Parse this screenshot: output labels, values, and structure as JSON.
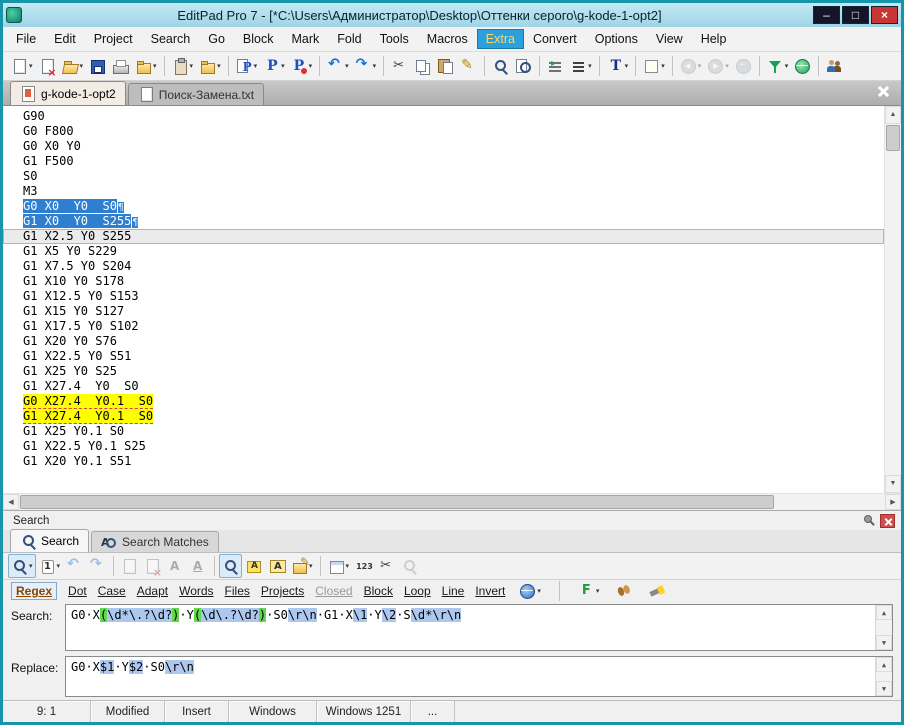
{
  "window": {
    "title": "EditPad Pro 7 - [*C:\\Users\\Администратор\\Desktop\\Оттенки серого\\g-kode-1-opt2]",
    "controls": [
      {
        "name": "minimize",
        "glyph": "–"
      },
      {
        "name": "maximize",
        "glyph": "□"
      },
      {
        "name": "close",
        "glyph": "×"
      }
    ]
  },
  "glyphs": {
    "dropdown": "▾",
    "up": "▲",
    "down": "▼",
    "left": "◀",
    "right": "▶",
    "pilcrow": "¶"
  },
  "menu_bar": {
    "active": "Extra",
    "items": [
      "File",
      "Edit",
      "Project",
      "Search",
      "Go",
      "Block",
      "Mark",
      "Fold",
      "Tools",
      "Macros",
      "Extra",
      "Convert",
      "Options",
      "View",
      "Help"
    ]
  },
  "main_toolbar": [
    {
      "name": "new-file",
      "icon": "page",
      "dd": true
    },
    {
      "name": "close-file",
      "icon": "page-x"
    },
    {
      "name": "open-file",
      "icon": "folder-open",
      "dd": true
    },
    {
      "name": "save",
      "icon": "floppy"
    },
    {
      "name": "print",
      "icon": "printer"
    },
    {
      "name": "favorites",
      "icon": "folder",
      "dd": true
    },
    {
      "sep": true
    },
    {
      "name": "clipboard-file",
      "icon": "clip",
      "dd": true
    },
    {
      "name": "export",
      "icon": "folder",
      "dd": true
    },
    {
      "sep": true
    },
    {
      "name": "open-project",
      "icon": "P-page",
      "dd": true
    },
    {
      "name": "save-project",
      "icon": "P",
      "dd": true
    },
    {
      "name": "close-project",
      "icon": "P-x",
      "dd": true
    },
    {
      "sep": true
    },
    {
      "name": "undo",
      "icon": "undo",
      "dd": true
    },
    {
      "name": "redo",
      "icon": "redo",
      "dd": true
    },
    {
      "sep": true
    },
    {
      "name": "cut",
      "icon": "cut"
    },
    {
      "name": "copy",
      "icon": "copy"
    },
    {
      "name": "paste",
      "icon": "paste"
    },
    {
      "name": "edit",
      "icon": "pencil"
    },
    {
      "sep": true
    },
    {
      "name": "search",
      "icon": "mag"
    },
    {
      "name": "search-files",
      "icon": "mag-doc"
    },
    {
      "sep": true
    },
    {
      "name": "indent",
      "icon": "indent"
    },
    {
      "name": "view-list",
      "icon": "list",
      "dd": true
    },
    {
      "sep": true
    },
    {
      "name": "font",
      "icon": "T",
      "dd": true
    },
    {
      "sep": true
    },
    {
      "name": "insert-symbol",
      "icon": "box",
      "dd": true
    },
    {
      "sep": true
    },
    {
      "name": "nav-back",
      "icon": "nav-back",
      "dd": true,
      "disabled": true
    },
    {
      "name": "nav-forward",
      "icon": "nav-fwd",
      "dd": true,
      "disabled": true
    },
    {
      "name": "nav-stop",
      "icon": "nav-stop",
      "disabled": true
    },
    {
      "sep": true
    },
    {
      "name": "filter",
      "icon": "funnel",
      "dd": true
    },
    {
      "name": "help-web",
      "icon": "globe"
    },
    {
      "sep": true
    },
    {
      "name": "forum",
      "icon": "people"
    }
  ],
  "document_tabs": [
    {
      "label": "g-kode-1-opt2",
      "active": true
    },
    {
      "label": "Поиск-Замена.txt",
      "active": false
    }
  ],
  "editor": {
    "lines": [
      {
        "text": "G90"
      },
      {
        "text": "G0 F800"
      },
      {
        "text": "G0 X0 Y0"
      },
      {
        "text": "G1 F500"
      },
      {
        "text": "S0"
      },
      {
        "text": "M3"
      },
      {
        "text": "G0 X0  Y0  S0",
        "hl": "selection",
        "eol": true
      },
      {
        "text": "G1 X0  Y0  S255",
        "hl": "selection",
        "eol": true
      },
      {
        "text": "G1 X2.5 Y0 S255",
        "hl": "current"
      },
      {
        "text": "G1 X5 Y0 S229"
      },
      {
        "text": "G1 X7.5 Y0 S204"
      },
      {
        "text": "G1 X10 Y0 S178"
      },
      {
        "text": "G1 X12.5 Y0 S153"
      },
      {
        "text": "G1 X15 Y0 S127"
      },
      {
        "text": "G1 X17.5 Y0 S102"
      },
      {
        "text": "G1 X20 Y0 S76"
      },
      {
        "text": "G1 X22.5 Y0 S51"
      },
      {
        "text": "G1 X25 Y0 S25"
      },
      {
        "text": "G1 X27.4  Y0  S0"
      },
      {
        "text": "G0 X27.4  Y0.1  S0",
        "hl": "match"
      },
      {
        "text": "G1 X27.4  Y0.1  S0",
        "hl": "match"
      },
      {
        "text": "G1 X25 Y0.1 S0"
      },
      {
        "text": "G1 X22.5 Y0.1 S25"
      },
      {
        "text": "G1 X20 Y0.1 S51"
      }
    ]
  },
  "search_panel": {
    "caption": "Search",
    "tabs": [
      {
        "label": "Search",
        "icon": "mag",
        "active": true
      },
      {
        "label": "Search Matches",
        "icon": "A-mag",
        "active": false
      }
    ],
    "toolbar": [
      {
        "name": "search-action",
        "icon": "mag",
        "dd": true,
        "pressed": true
      },
      {
        "name": "search-scope",
        "icon": "one",
        "dd": true
      },
      {
        "name": "find-previous",
        "icon": "undo",
        "disabled": true
      },
      {
        "name": "find-next",
        "icon": "redo",
        "disabled": true
      },
      {
        "sep": true
      },
      {
        "name": "replace-previous",
        "icon": "page",
        "disabled": true
      },
      {
        "name": "replace-current",
        "icon": "page-x",
        "disabled": true
      },
      {
        "name": "replace-next",
        "icon": "A",
        "disabled": true
      },
      {
        "name": "replace-and-find",
        "icon": "Aul",
        "disabled": true
      },
      {
        "sep": true
      },
      {
        "name": "find-first",
        "icon": "mag",
        "pressed": true
      },
      {
        "name": "highlight-matches",
        "icon": "highlight"
      },
      {
        "name": "list-all-matches",
        "icon": "A-box"
      },
      {
        "name": "replace-all",
        "icon": "folder-pencil",
        "dd": true
      },
      {
        "sep": true
      },
      {
        "name": "columns",
        "icon": "grid",
        "dd": true
      },
      {
        "name": "count-matches",
        "icon": "123"
      },
      {
        "name": "cut-matches",
        "icon": "cut"
      },
      {
        "name": "search-preview",
        "icon": "mag-gray",
        "disabled": true
      }
    ],
    "options": [
      {
        "label": "Regex",
        "active": true
      },
      {
        "label": "Dot"
      },
      {
        "label": "Case"
      },
      {
        "label": "Adapt"
      },
      {
        "label": "Words"
      },
      {
        "label": "Files"
      },
      {
        "label": "Projects"
      },
      {
        "label": "Closed",
        "disabled": true
      },
      {
        "label": "Block"
      },
      {
        "label": "Loop"
      },
      {
        "label": "Line"
      },
      {
        "label": "Invert"
      },
      {
        "icon": "globe-blue",
        "name": "scheme",
        "dd": true
      },
      {
        "sep": true
      },
      {
        "icon": "F",
        "name": "search-favorites",
        "dd": true
      },
      {
        "icon": "moth",
        "name": "debug-regex"
      },
      {
        "icon": "flash",
        "name": "regex-flashlight"
      }
    ],
    "search_label": "Search:",
    "replace_label": "Replace:",
    "search_segments": [
      {
        "t": "G0·X",
        "c": "p"
      },
      {
        "t": "(",
        "c": "g"
      },
      {
        "t": "\\d*\\.?\\d?",
        "c": "b"
      },
      {
        "t": ")",
        "c": "g"
      },
      {
        "t": "·Y",
        "c": "p"
      },
      {
        "t": "(",
        "c": "g"
      },
      {
        "t": "\\d\\.?\\d?",
        "c": "b"
      },
      {
        "t": ")",
        "c": "g"
      },
      {
        "t": "·S0",
        "c": "p"
      },
      {
        "t": "\\r\\n",
        "c": "b"
      },
      {
        "t": "·G1·X",
        "c": "p"
      },
      {
        "t": "\\1",
        "c": "b"
      },
      {
        "t": "·Y",
        "c": "p"
      },
      {
        "t": "\\2",
        "c": "b"
      },
      {
        "t": "·S",
        "c": "p"
      },
      {
        "t": "\\d*",
        "c": "b"
      },
      {
        "t": "\\r\\n",
        "c": "b"
      }
    ],
    "replace_segments": [
      {
        "t": "G0·X",
        "c": "p"
      },
      {
        "t": "$1",
        "c": "b"
      },
      {
        "t": "·Y",
        "c": "p"
      },
      {
        "t": "$2",
        "c": "b"
      },
      {
        "t": "·S0",
        "c": "p"
      },
      {
        "t": "\\r\\n",
        "c": "b"
      }
    ]
  },
  "status_bar": {
    "cells": [
      {
        "name": "caret-position",
        "text": "9: 1"
      },
      {
        "name": "modified-state",
        "text": "Modified"
      },
      {
        "name": "insert-mode",
        "text": "Insert"
      },
      {
        "name": "line-break-style",
        "text": "Windows"
      },
      {
        "name": "encoding",
        "text": "Windows 1251"
      },
      {
        "name": "more",
        "text": "..."
      }
    ]
  }
}
